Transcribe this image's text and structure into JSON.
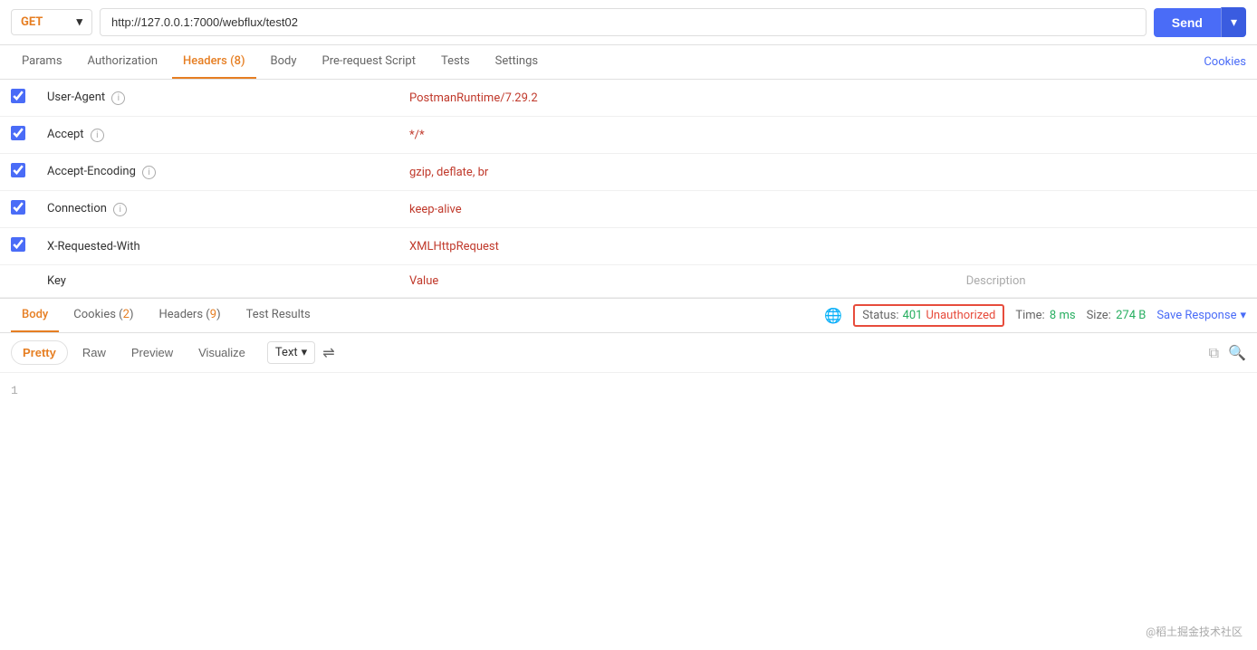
{
  "url_bar": {
    "method": "GET",
    "url": "http://127.0.0.1:7000/webflux/test02",
    "send_label": "Send"
  },
  "request_tabs": {
    "items": [
      {
        "id": "params",
        "label": "Params",
        "active": false
      },
      {
        "id": "authorization",
        "label": "Authorization",
        "active": false
      },
      {
        "id": "headers",
        "label": "Headers",
        "count": "8",
        "active": true
      },
      {
        "id": "body",
        "label": "Body",
        "active": false
      },
      {
        "id": "pre-request-script",
        "label": "Pre-request Script",
        "active": false
      },
      {
        "id": "tests",
        "label": "Tests",
        "active": false
      },
      {
        "id": "settings",
        "label": "Settings",
        "active": false
      }
    ],
    "cookies_label": "Cookies"
  },
  "headers": [
    {
      "checked": true,
      "key": "User-Agent",
      "value": "PostmanRuntime/7.29.2",
      "description": ""
    },
    {
      "checked": true,
      "key": "Accept",
      "value": "*/*",
      "description": ""
    },
    {
      "checked": true,
      "key": "Accept-Encoding",
      "value": "gzip, deflate, br",
      "description": ""
    },
    {
      "checked": true,
      "key": "Connection",
      "value": "keep-alive",
      "description": ""
    },
    {
      "checked": true,
      "key": "X-Requested-With",
      "value": "XMLHttpRequest",
      "description": ""
    }
  ],
  "headers_placeholder": {
    "key": "Key",
    "value": "Value",
    "description": "Description"
  },
  "response_tabs": {
    "items": [
      {
        "id": "body",
        "label": "Body",
        "active": true
      },
      {
        "id": "cookies",
        "label": "Cookies",
        "count": "2",
        "active": false
      },
      {
        "id": "headers",
        "label": "Headers",
        "count": "9",
        "active": false
      },
      {
        "id": "test-results",
        "label": "Test Results",
        "active": false
      }
    ]
  },
  "response_meta": {
    "status_label": "Status:",
    "status_code": "401",
    "status_text": "Unauthorized",
    "time_label": "Time:",
    "time_value": "8 ms",
    "size_label": "Size:",
    "size_value": "274 B",
    "save_response_label": "Save Response"
  },
  "body_toolbar": {
    "formats": [
      {
        "id": "pretty",
        "label": "Pretty",
        "active": true
      },
      {
        "id": "raw",
        "label": "Raw",
        "active": false
      },
      {
        "id": "preview",
        "label": "Preview",
        "active": false
      },
      {
        "id": "visualize",
        "label": "Visualize",
        "active": false
      }
    ],
    "text_select": "Text"
  },
  "response_body": {
    "line_number": "1",
    "content": ""
  },
  "watermark": "@稻土掘金技术社区"
}
